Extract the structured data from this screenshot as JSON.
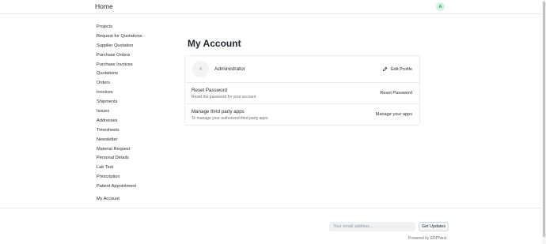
{
  "navbar": {
    "brand": "Home",
    "avatar_initial": "A"
  },
  "sidebar": {
    "items": [
      "Projects",
      "Request for Quotations",
      "Supplier Quotation",
      "Purchase Orders",
      "Purchase Invoices",
      "Quotations",
      "Orders",
      "Invoices",
      "Shipments",
      "Issues",
      "Addresses",
      "Timesheets",
      "Newsletter",
      "Material Request",
      "Personal Details",
      "Lab Test",
      "Prescription",
      "Patient Appointment"
    ],
    "my_account": "My Account"
  },
  "main": {
    "title": "My Account",
    "profile": {
      "avatar_initial": "A",
      "name": "Administrator",
      "edit_label": "Edit Profile"
    },
    "reset": {
      "title": "Reset Password",
      "description": "Reset the password for your account",
      "action": "Reset Password"
    },
    "apps": {
      "title": "Manage third party apps",
      "description": "To manage your authorized third party apps",
      "action": "Manage your apps"
    }
  },
  "footer": {
    "email_placeholder": "Your email address...",
    "subscribe_label": "Get Updates",
    "powered_by": "Powered by ERPNext"
  },
  "icons": {
    "edit": "pencil-icon"
  }
}
